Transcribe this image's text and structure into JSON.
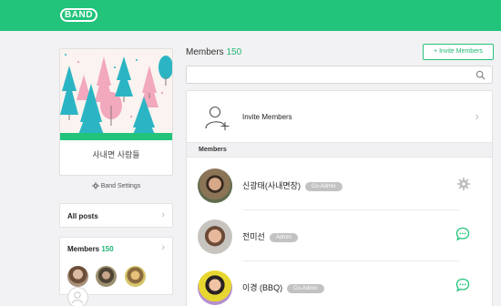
{
  "brand": {
    "logo_text": "BAND",
    "accent": "#21c47a"
  },
  "band": {
    "name": "사내면 사람들",
    "settings_label": "Band Settings"
  },
  "sidebar": {
    "all_posts": "All posts",
    "members_label": "Members",
    "members_count": "150"
  },
  "main": {
    "title": "Members",
    "count": "150",
    "invite_button": "+ Invite Members",
    "search_placeholder": "",
    "invite_row_label": "Invite Members",
    "section_label": "Members",
    "members": [
      {
        "name": "신광태(사내면장)",
        "role": "Co-Admin",
        "action_icon": "gear-icon"
      },
      {
        "name": "전미선",
        "role": "Admin",
        "action_icon": "chat-icon"
      },
      {
        "name": "이경 (BBQ)",
        "role": "Co-Admin",
        "action_icon": "chat-icon"
      }
    ]
  }
}
